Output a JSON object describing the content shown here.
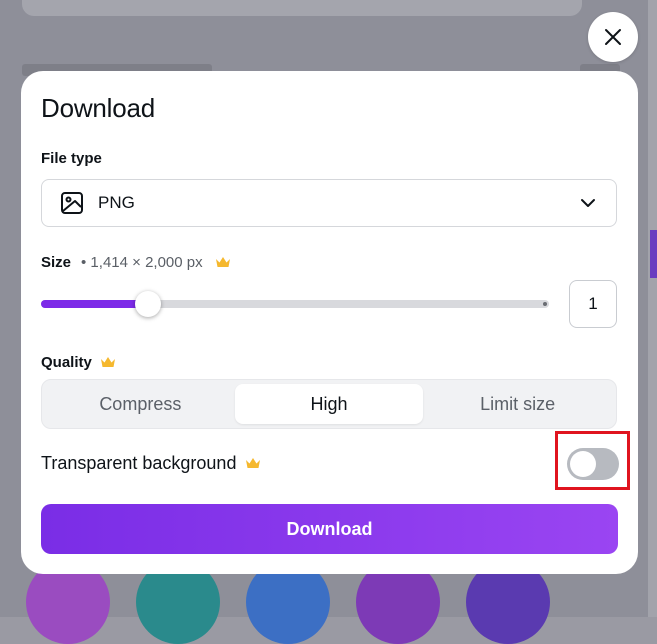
{
  "dialog": {
    "title": "Download",
    "file_type": {
      "label": "File type",
      "selected": "PNG"
    },
    "size": {
      "label": "Size",
      "dimensions": "• 1,414 × 2,000 px",
      "scale_value": "1",
      "slider_fraction": 0.21
    },
    "quality": {
      "label": "Quality",
      "options": [
        "Compress",
        "High",
        "Limit size"
      ],
      "selected": "High"
    },
    "transparent_background": {
      "label": "Transparent background",
      "enabled": false
    },
    "download_button_label": "Download"
  },
  "colors": {
    "accent": "#7d2ae8",
    "premium_crown": "#f5b82e",
    "highlight_box": "#e0141f"
  },
  "icons": {
    "close": "close-icon",
    "file_type": "image-icon",
    "dropdown": "chevron-down-icon",
    "premium": "crown-icon"
  }
}
